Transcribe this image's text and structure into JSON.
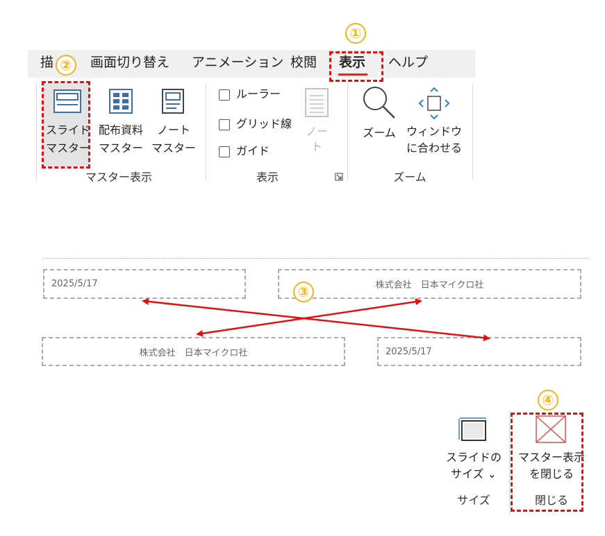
{
  "tabs": [
    {
      "label": "描"
    },
    {
      "label": "画面切り替え"
    },
    {
      "label": "アニメーション"
    },
    {
      "label": "校閲"
    },
    {
      "label": "表示",
      "active": true
    },
    {
      "label": "ヘルプ"
    }
  ],
  "ribbon": {
    "slide_master": {
      "line1": "スライド",
      "line2": "マスター"
    },
    "handout_master": {
      "line1": "配布資料",
      "line2": "マスター"
    },
    "notes_master": {
      "line1": "ノート",
      "line2": "マスター"
    },
    "master_group_label": "マスター表示",
    "checkboxes": [
      "ルーラー",
      "グリッド線",
      "ガイド"
    ],
    "notes_button": {
      "line1": "ノー",
      "line2": "ト"
    },
    "show_group_label": "表示",
    "zoom_button": "ズーム",
    "fit_window": {
      "line1": "ウィンドウ",
      "line2": "に合わせる"
    },
    "zoom_group_label": "ズーム"
  },
  "placeholders": {
    "top_date": "2025/5/17",
    "top_company": "株式会社　日本マイクロ社",
    "bottom_company": "株式会社　日本マイクロ社",
    "bottom_date": "2025/5/17"
  },
  "closing_ribbon": {
    "slide_size": {
      "line1": "スライドの",
      "line2": "サイズ ⌄"
    },
    "size_group_label": "サイズ",
    "close_master": {
      "line1": "マスター表示",
      "line2": "を閉じる"
    },
    "close_group_label": "閉じる"
  },
  "callouts": [
    "①",
    "②",
    "③",
    "④"
  ],
  "colors": {
    "highlight_dash": "#e01010",
    "callout": "#f3b41a",
    "arrow": "#e01010",
    "active_tab_underline": "#c0392b"
  }
}
